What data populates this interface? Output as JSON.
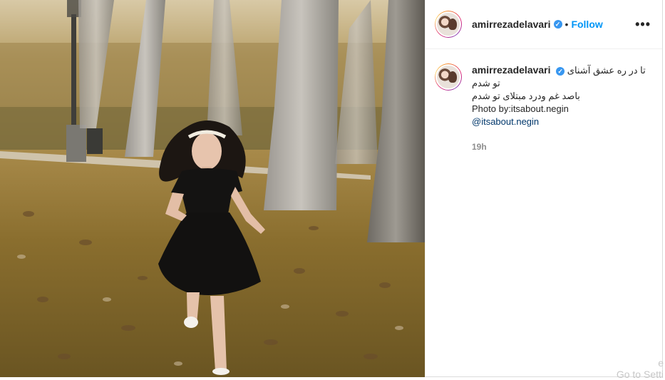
{
  "post": {
    "username": "amirrezadelavari",
    "follow_label": "Follow",
    "dot": "•",
    "verified_icon": "check",
    "more_label": "•••"
  },
  "caption": {
    "username": "amirrezadelavari",
    "line1": "تا در ره عشق آشنای",
    "line2": "تو شدم",
    "line3": "باصد غم ودرد مبتلای تو شدم",
    "line4": "Photo by:itsabout.negin",
    "mention": "@itsabout.negin",
    "time": "19h"
  },
  "colors": {
    "link": "#0095f6",
    "mention": "#00376b",
    "verified": "#3897f0",
    "text": "#262626",
    "muted": "#8e8e8e"
  },
  "watermark": {
    "line1": "e",
    "line2": "Go to Setti"
  }
}
